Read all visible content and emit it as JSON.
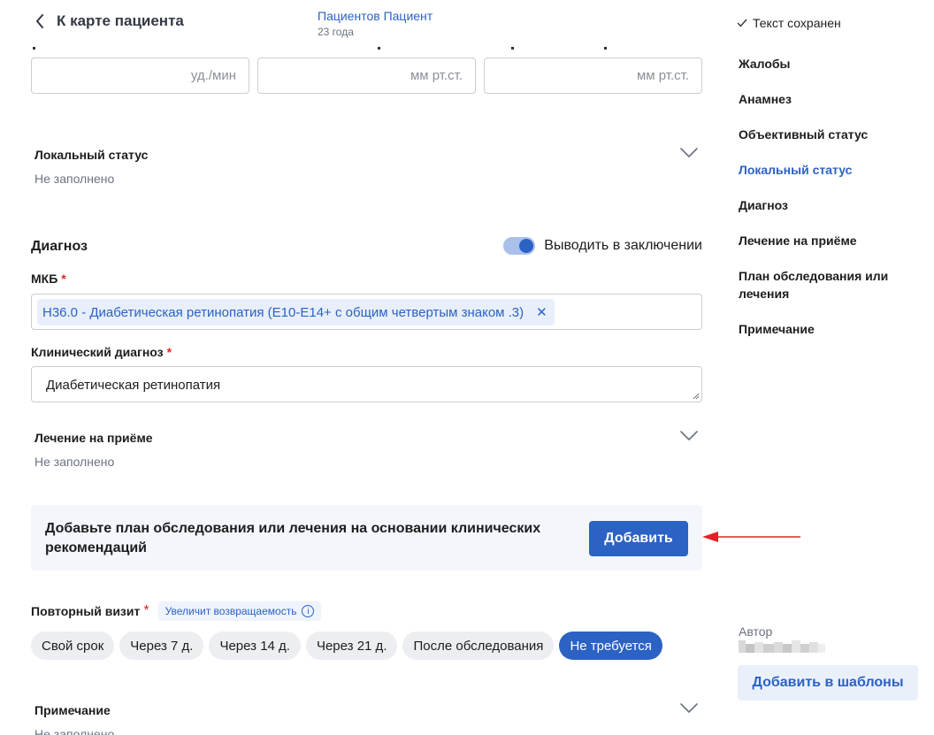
{
  "header": {
    "back_label": "К карте пациента",
    "patient_name": "Пациентов Пациент",
    "patient_age": "23 года"
  },
  "vitals": {
    "fields": [
      {
        "unit": "уд./мин"
      },
      {
        "unit": "мм рт.ст."
      },
      {
        "unit": "мм рт.ст."
      }
    ]
  },
  "local_status": {
    "title": "Локальный статус",
    "value": "Не заполнено"
  },
  "diagnosis": {
    "title": "Диагноз",
    "toggle_label": "Выводить в заключении",
    "toggle_on": true,
    "mkb_label": "МКБ",
    "mkb_required": "*",
    "mkb_chip": "H36.0 - Диабетическая ретинопатия (E10-E14+ с общим четвертым знаком .3)",
    "mkb_chip_remove": "✕",
    "clinical_label": "Клинический диагноз",
    "clinical_required": "*",
    "clinical_value": "Диабетическая ретинопатия"
  },
  "treatment": {
    "title": "Лечение на приёме",
    "value": "Не заполнено"
  },
  "plan_card": {
    "text": "Добавьте план обследования или лечения на основании клинических рекомендаций",
    "button": "Добавить"
  },
  "revisit": {
    "title": "Повторный визит",
    "required": "*",
    "hint": "Увеличит возвращаемость",
    "hint_icon": "i",
    "options": [
      {
        "label": "Свой срок",
        "active": false
      },
      {
        "label": "Через 7 д.",
        "active": false
      },
      {
        "label": "Через 14 д.",
        "active": false
      },
      {
        "label": "Через 21 д.",
        "active": false
      },
      {
        "label": "После обследования",
        "active": false
      },
      {
        "label": "Не требуется",
        "active": true
      }
    ]
  },
  "note": {
    "title": "Примечание",
    "value": "Не заполнено"
  },
  "sidebar": {
    "saved_status": "Текст сохранен",
    "items": [
      {
        "label": "Жалобы",
        "active": false
      },
      {
        "label": "Анамнез",
        "active": false
      },
      {
        "label": "Объективный статус",
        "active": false
      },
      {
        "label": "Локальный статус",
        "active": true
      },
      {
        "label": "Диагноз",
        "active": false
      },
      {
        "label": "Лечение на приёме",
        "active": false
      },
      {
        "label": "План обследования или лечения",
        "active": false
      },
      {
        "label": "Примечание",
        "active": false
      }
    ],
    "author_label": "Автор",
    "templates_button": "Добавить в шаблоны"
  },
  "colors": {
    "accent": "#2b62c4",
    "required": "#e02424",
    "annotation_arrow": "#e02424"
  }
}
